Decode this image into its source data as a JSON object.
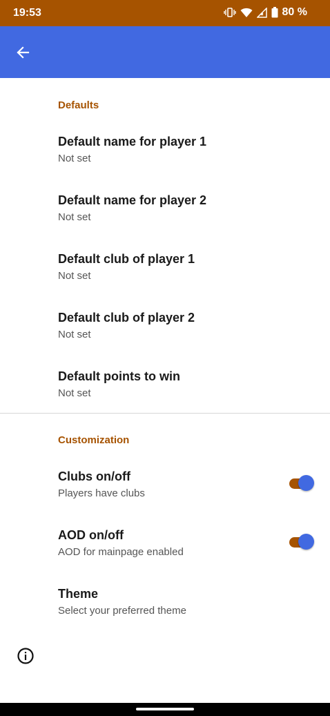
{
  "status_bar": {
    "time": "19:53",
    "battery": "80 %",
    "icons": [
      "vibrate-icon",
      "wifi-icon",
      "signal-icon",
      "battery-icon"
    ]
  },
  "app_bar": {
    "color": "#4169e1",
    "back_icon": "arrow-back-icon"
  },
  "accent_color": "#a65300",
  "sections": [
    {
      "header": "Defaults",
      "items": [
        {
          "title": "Default name for player 1",
          "summary": "Not set"
        },
        {
          "title": "Default name for player 2",
          "summary": "Not set"
        },
        {
          "title": "Default club of player 1",
          "summary": "Not set"
        },
        {
          "title": "Default club of player 2",
          "summary": "Not set"
        },
        {
          "title": "Default points to win",
          "summary": "Not set"
        }
      ]
    },
    {
      "header": "Customization",
      "items": [
        {
          "title": "Clubs on/off",
          "summary": "Players have clubs",
          "switch_on": true
        },
        {
          "title": "AOD on/off",
          "summary": "AOD for mainpage enabled",
          "switch_on": true
        },
        {
          "title": "Theme",
          "summary": "Select your preferred theme"
        }
      ]
    }
  ],
  "footer": {
    "info_icon": "info-icon"
  }
}
